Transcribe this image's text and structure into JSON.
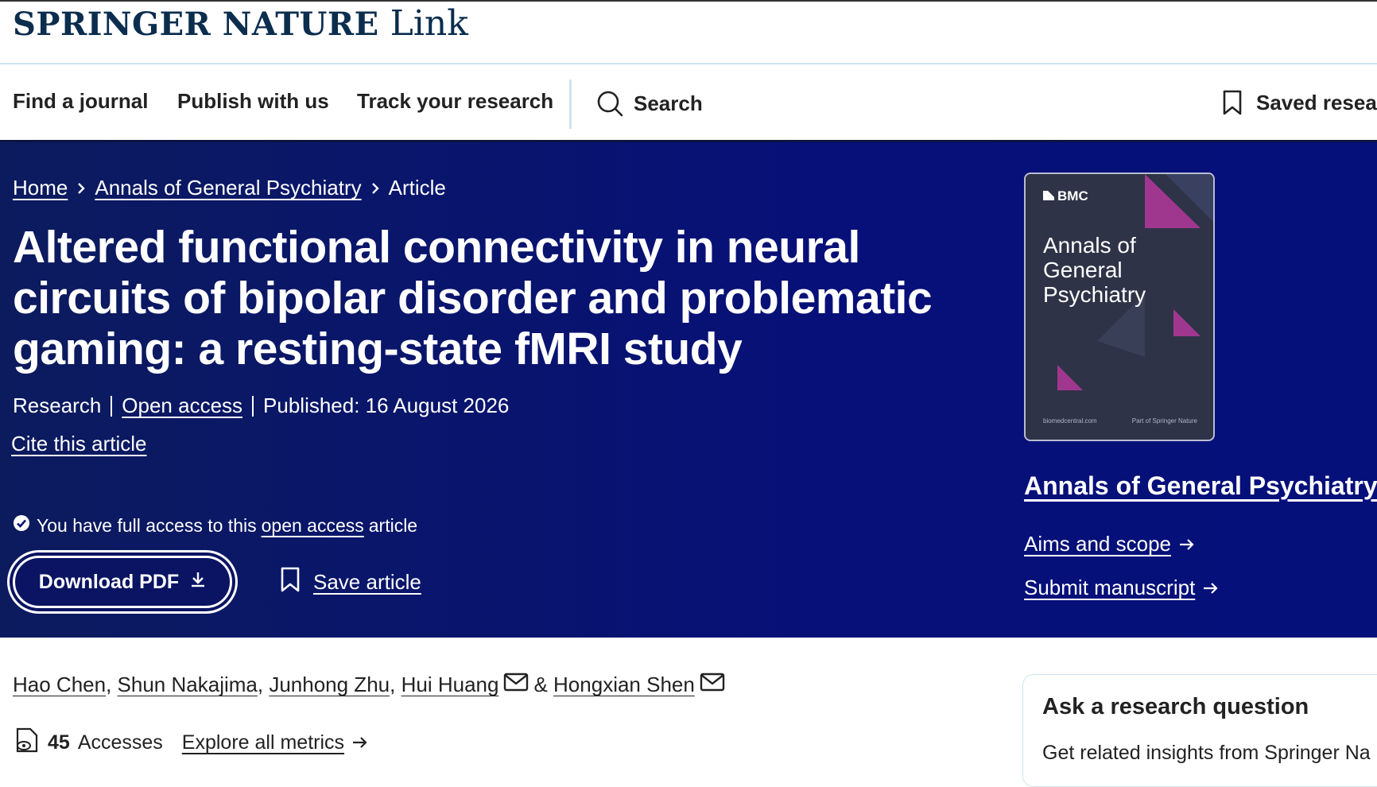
{
  "brand": {
    "name": "SPRINGER NATURE",
    "product": "Link"
  },
  "nav": {
    "items": [
      "Find a journal",
      "Publish with us",
      "Track your research"
    ],
    "search_label": "Search",
    "saved_label": "Saved resear"
  },
  "breadcrumb": {
    "home": "Home",
    "journal": "Annals of General Psychiatry",
    "current": "Article"
  },
  "article": {
    "title": "Altered functional connectivity in neural circuits of bipolar disorder and problematic gaming: a resting-state fMRI study",
    "type": "Research",
    "access_label": "Open access",
    "published": "Published: 16 August 2026",
    "cite_label": "Cite this article"
  },
  "access_notice": {
    "prefix": "You have full access to this",
    "link": "open access",
    "suffix": "article"
  },
  "actions": {
    "download_label": "Download PDF",
    "save_label": "Save article"
  },
  "journal_sidebar": {
    "cover_publisher": "BMC",
    "cover_title": "Annals of General Psychiatry",
    "cover_footer_left": "biomedcentral.com",
    "cover_footer_right": "Part of Springer Nature",
    "journal_name": "Annals of General Psychiatry",
    "aims_label": "Aims and scope",
    "submit_label": "Submit manuscript"
  },
  "authors": [
    "Hao Chen",
    "Shun Nakajima",
    "Junhong Zhu",
    "Hui Huang",
    "Hongxian Shen"
  ],
  "author_sep": ",",
  "author_amp": "&",
  "metrics": {
    "count": "45",
    "label": "Accesses",
    "explore_label": "Explore all metrics"
  },
  "ask_panel": {
    "title": "Ask a research question",
    "text": "Get related insights from Springer Na"
  },
  "colors": {
    "hero_bg": "#071078",
    "brand": "#0b2d4e",
    "cover_bg": "#2e3347",
    "cover_accent": "#a0378f"
  }
}
